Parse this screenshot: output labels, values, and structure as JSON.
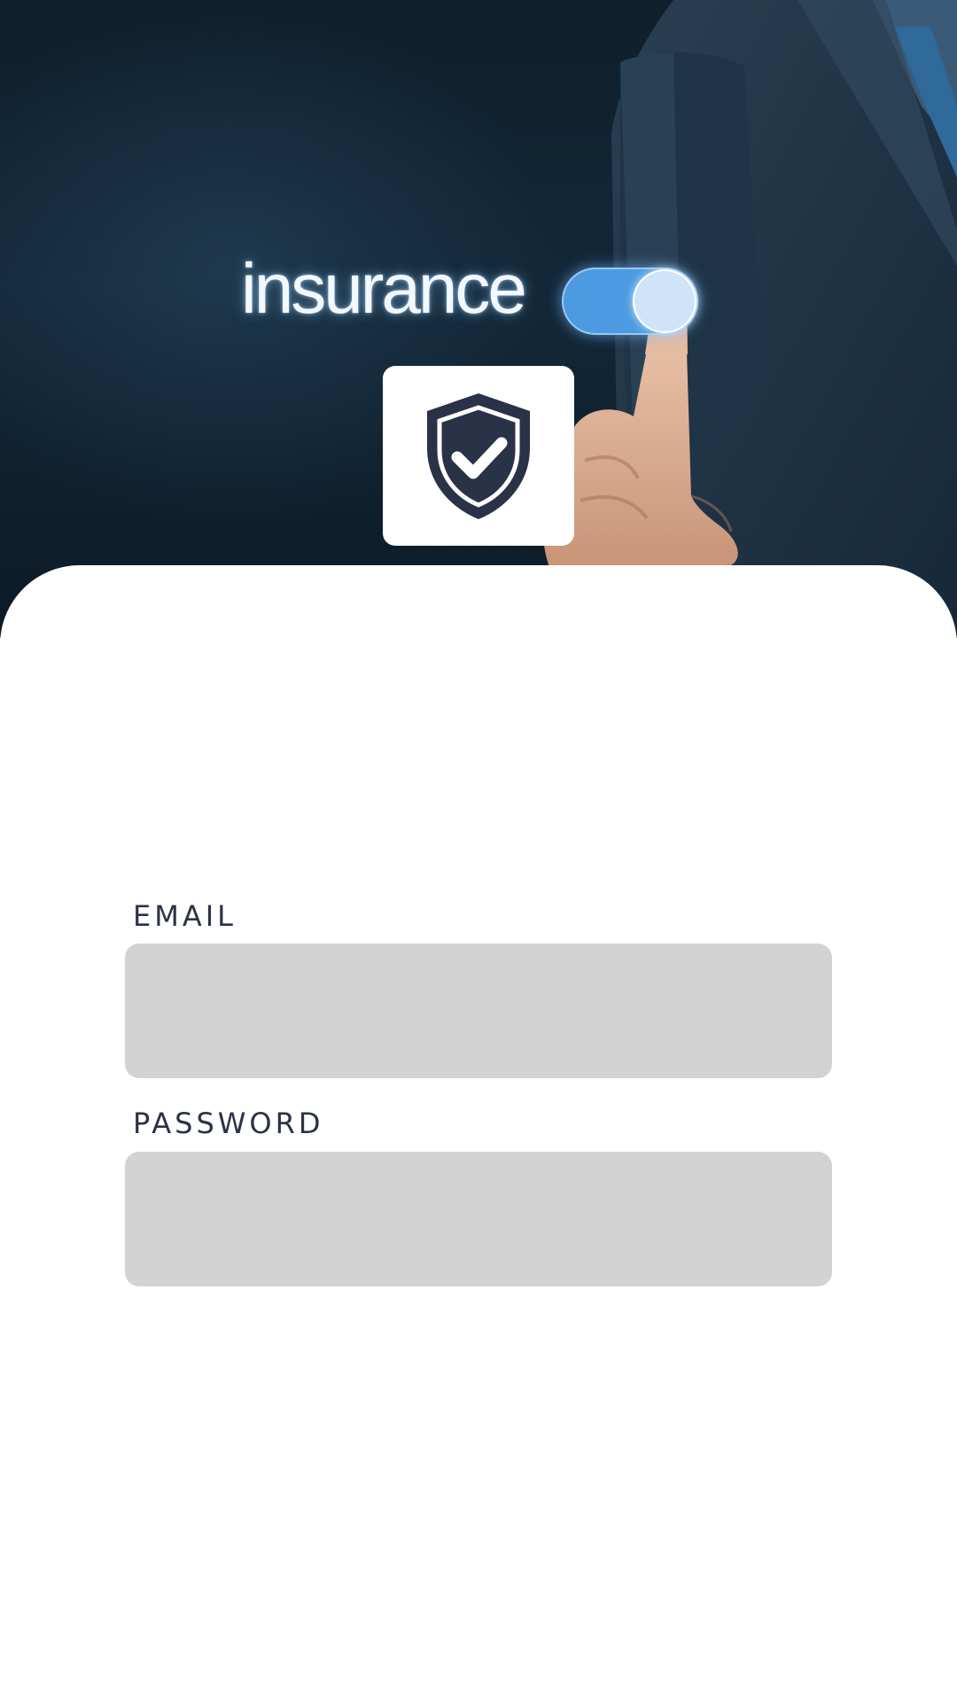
{
  "hero": {
    "word": "insurance",
    "toggle_state": "on",
    "badge_icon": "shield-check-icon",
    "colors": {
      "background": "#132838",
      "toggle": "#4c9be0",
      "shield": "#2a3247"
    }
  },
  "form": {
    "email": {
      "label": "EMAIL",
      "value": "",
      "placeholder": ""
    },
    "password": {
      "label": "PASSWORD",
      "value": "",
      "placeholder": ""
    }
  }
}
